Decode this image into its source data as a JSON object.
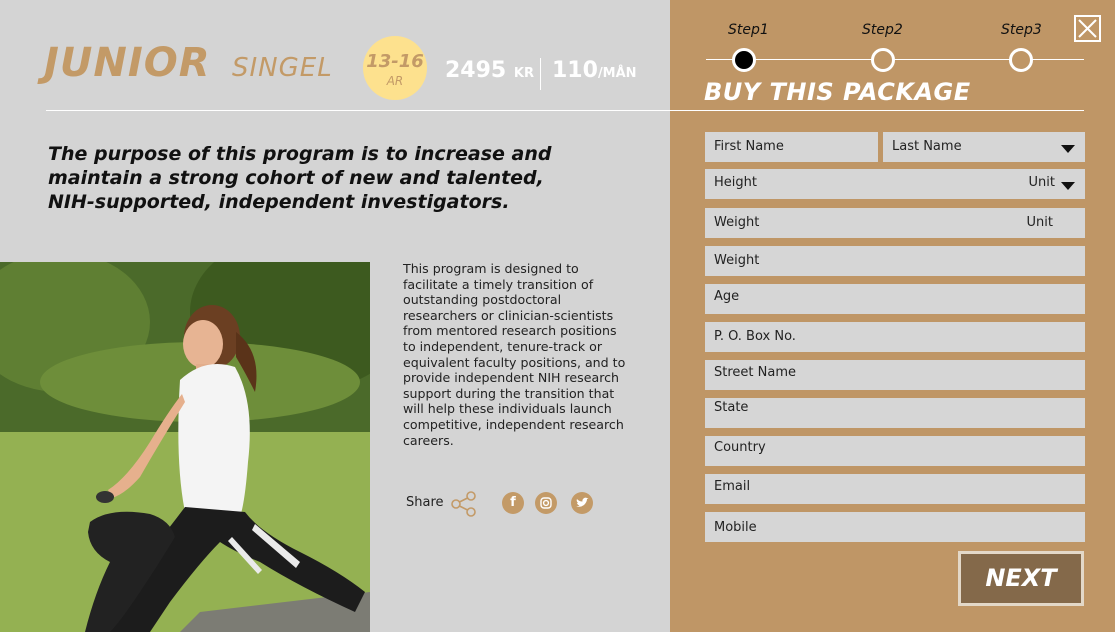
{
  "package": {
    "title_main": "JUNIOR",
    "title_sub": "SINGEL",
    "age_range": "13-16",
    "age_unit": "AR",
    "price": "2495",
    "price_unit": "KR",
    "monthly": "110",
    "monthly_unit": "/MÅN"
  },
  "purpose_text": "The purpose of this program is to increase and maintain a strong cohort of new and talented, NIH-supported, independent investigators.",
  "description": "This program is designed to facilitate a timely transition of outstanding postdoctoral researchers or clinician-scientists from mentored research positions to independent, tenure-track or equivalent faculty positions, and to provide independent NIH research support during the transition that will help these individuals launch competitive, independent research careers.",
  "share": {
    "label": "Share",
    "icons": [
      "share-icon",
      "facebook-icon",
      "instagram-icon",
      "twitter-icon"
    ]
  },
  "steps": [
    {
      "label": "Step1",
      "active": true
    },
    {
      "label": "Step2",
      "active": false
    },
    {
      "label": "Step3",
      "active": false
    }
  ],
  "form": {
    "title": "BUY THIS PACKAGE",
    "first_name": "First Name",
    "last_name": "Last Name",
    "height": "Height",
    "height_unit": "Unit",
    "weight": "Weight",
    "weight_unit": "Unit",
    "weight2": "Weight",
    "age": "Age",
    "po_box": "P. O. Box No.",
    "street": "Street Name",
    "state": "State",
    "country": "Country",
    "email": "Email",
    "mobile": "Mobile",
    "next_label": "NEXT"
  },
  "colors": {
    "accent": "#c39a67",
    "panel": "#bf9666",
    "badge": "#fde18e",
    "background": "#d4d4d4",
    "button": "#84694a"
  }
}
